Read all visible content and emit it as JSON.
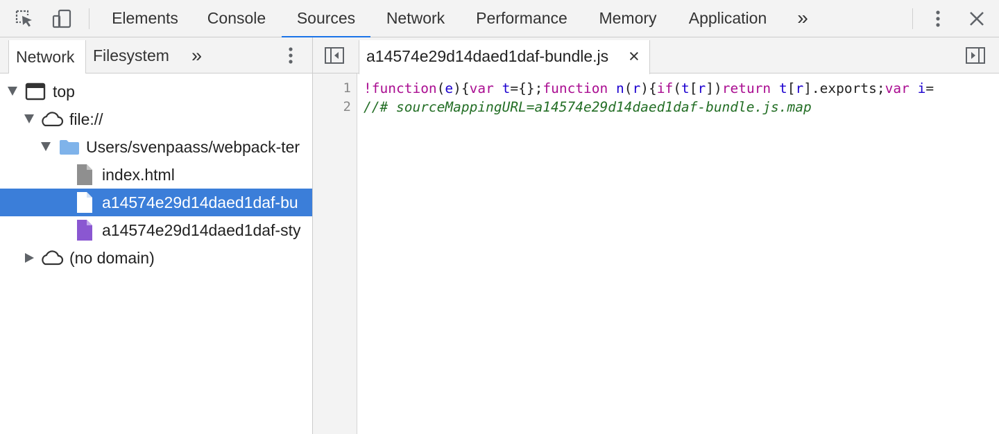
{
  "toolbar": {
    "tabs": [
      "Elements",
      "Console",
      "Sources",
      "Network",
      "Performance",
      "Memory",
      "Application"
    ],
    "active_tab": "Sources",
    "more_label": "»",
    "menu_icon": "kebab-menu-icon",
    "close_icon": "close-icon"
  },
  "navigator": {
    "tabs": [
      "Network",
      "Filesystem"
    ],
    "active_tab": "Network",
    "more_label": "»",
    "tree": [
      {
        "label": "top",
        "icon": "frame-icon",
        "expanded": true
      },
      {
        "label": "file://",
        "icon": "cloud-icon",
        "expanded": true
      },
      {
        "label": "Users/svenpaass/webpack-ter",
        "icon": "folder-icon",
        "expanded": true
      },
      {
        "label": "index.html",
        "icon": "file-icon"
      },
      {
        "label": "a14574e29d14daed1daf-bu",
        "icon": "file-icon",
        "selected": true
      },
      {
        "label": "a14574e29d14daed1daf-sty",
        "icon": "file-icon"
      },
      {
        "label": "(no domain)",
        "icon": "cloud-icon",
        "expanded": false
      }
    ]
  },
  "editor": {
    "open_file": "a14574e29d14daed1daf-bundle.js",
    "close_label": "×",
    "line_numbers": [
      "1",
      "2"
    ],
    "lines": [
      "!function(e){var t={};function n(r){if(t[r])return t[r].exports;var i=",
      "//# sourceMappingURL=a14574e29d14daed1daf-bundle.js.map"
    ],
    "line1_tokens": [
      "!",
      "function",
      "(",
      "e",
      "){",
      "var",
      " ",
      "t",
      "={};",
      "function",
      " ",
      "n",
      "(",
      "r",
      "){",
      "if",
      "(",
      "t",
      "[",
      "r",
      "])",
      "return",
      " ",
      "t",
      "[",
      "r",
      "].exports;",
      "var",
      " ",
      "i",
      "="
    ]
  },
  "colors": {
    "accent": "#1a73e8",
    "selection": "#3b7ed9",
    "keyword": "#aa0d91",
    "variable": "#1c00cf",
    "comment": "#236e25"
  }
}
